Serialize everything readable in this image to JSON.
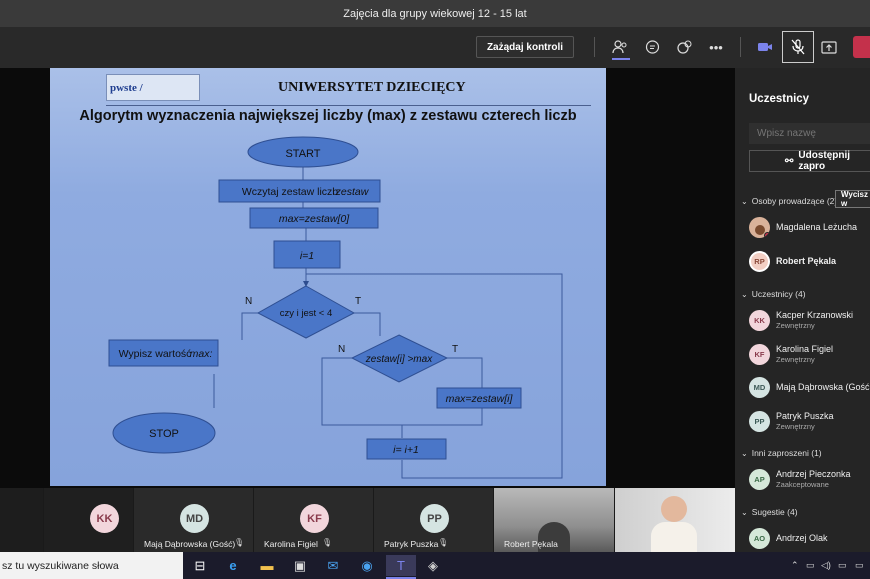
{
  "window": {
    "title": "Zajęcia dla grupy wiekowej 12 - 15 lat"
  },
  "toolbar": {
    "request_control_label": "Zażądaj kontroli",
    "icons": [
      "people-icon",
      "chat-icon",
      "reactions-icon",
      "more-icon",
      "camera-icon",
      "mic-off-icon",
      "share-icon",
      "leave-icon"
    ],
    "accent_leave": "#c4314b"
  },
  "slide": {
    "logo_text_1": "pwste",
    "logo_text_2": "/",
    "university": "UNIWERSYTET DZIECIĘCY",
    "title": "Algorytm wyznaczenia największej liczby (max) z zestawu czterech liczb",
    "flow": {
      "start": "START",
      "read_a": "Wczytaj zestaw liczb",
      "read_b": "zestaw",
      "init_max": "max=zestaw[0]",
      "init_i": "i=1",
      "cond1": "czy i jest < 4",
      "cond2": "zestaw[i] >max",
      "assign": "max=zestaw[i]",
      "inc": "i= i+1",
      "print_a": "Wypisz wartość ",
      "print_b": "max:",
      "stop": "STOP",
      "n1": "N",
      "t1": "T",
      "n2": "N",
      "t2": "T"
    }
  },
  "sidebar": {
    "header": "Uczestnicy",
    "search_placeholder": "Wpisz nazwę",
    "share_label": "Udostępnij zapro",
    "presenters_group": "Osoby prowadzące (2)",
    "mute_label": "Wycisz w",
    "presenters": [
      {
        "initials": "",
        "name": "Magdalena Leżucha"
      },
      {
        "initials": "RP",
        "name": "Robert Pękala"
      }
    ],
    "attendees_group": "Uczestnicy (4)",
    "attendees": [
      {
        "initials": "KK",
        "name": "Kacper Krzanowski",
        "sub": "Zewnętrzny"
      },
      {
        "initials": "KF",
        "name": "Karolina Figiel",
        "sub": "Zewnętrzny"
      },
      {
        "initials": "MD",
        "name": "Mają Dąbrowska (Gość",
        "sub": ""
      },
      {
        "initials": "PP",
        "name": "Patryk Puszka",
        "sub": "Zewnętrzny"
      }
    ],
    "invited_group": "Inni zaproszeni (1)",
    "invited": [
      {
        "initials": "AP",
        "name": "Andrzej Pieczonka",
        "sub": "Zaakceptowane"
      }
    ],
    "suggest_group": "Sugestie (4)",
    "suggest": [
      {
        "initials": "AO",
        "name": "Andrzej Olak"
      }
    ]
  },
  "strip": {
    "tiles": [
      {
        "initials": "KK",
        "name": ""
      },
      {
        "initials": "MD",
        "name": "Mają Dąbrowska (Gość)"
      },
      {
        "initials": "KF",
        "name": "Karolina Figiel"
      },
      {
        "initials": "PP",
        "name": "Patryk Puszka"
      },
      {
        "initials": "",
        "name": "Robert Pękala"
      }
    ]
  },
  "taskbar": {
    "search_text": "sz tu wyszukiwane słowa",
    "icons": [
      "task-view-icon",
      "edge-icon",
      "file-explorer-icon",
      "store-icon",
      "mail-icon",
      "safari-icon",
      "teams-icon",
      "app-icon"
    ]
  }
}
